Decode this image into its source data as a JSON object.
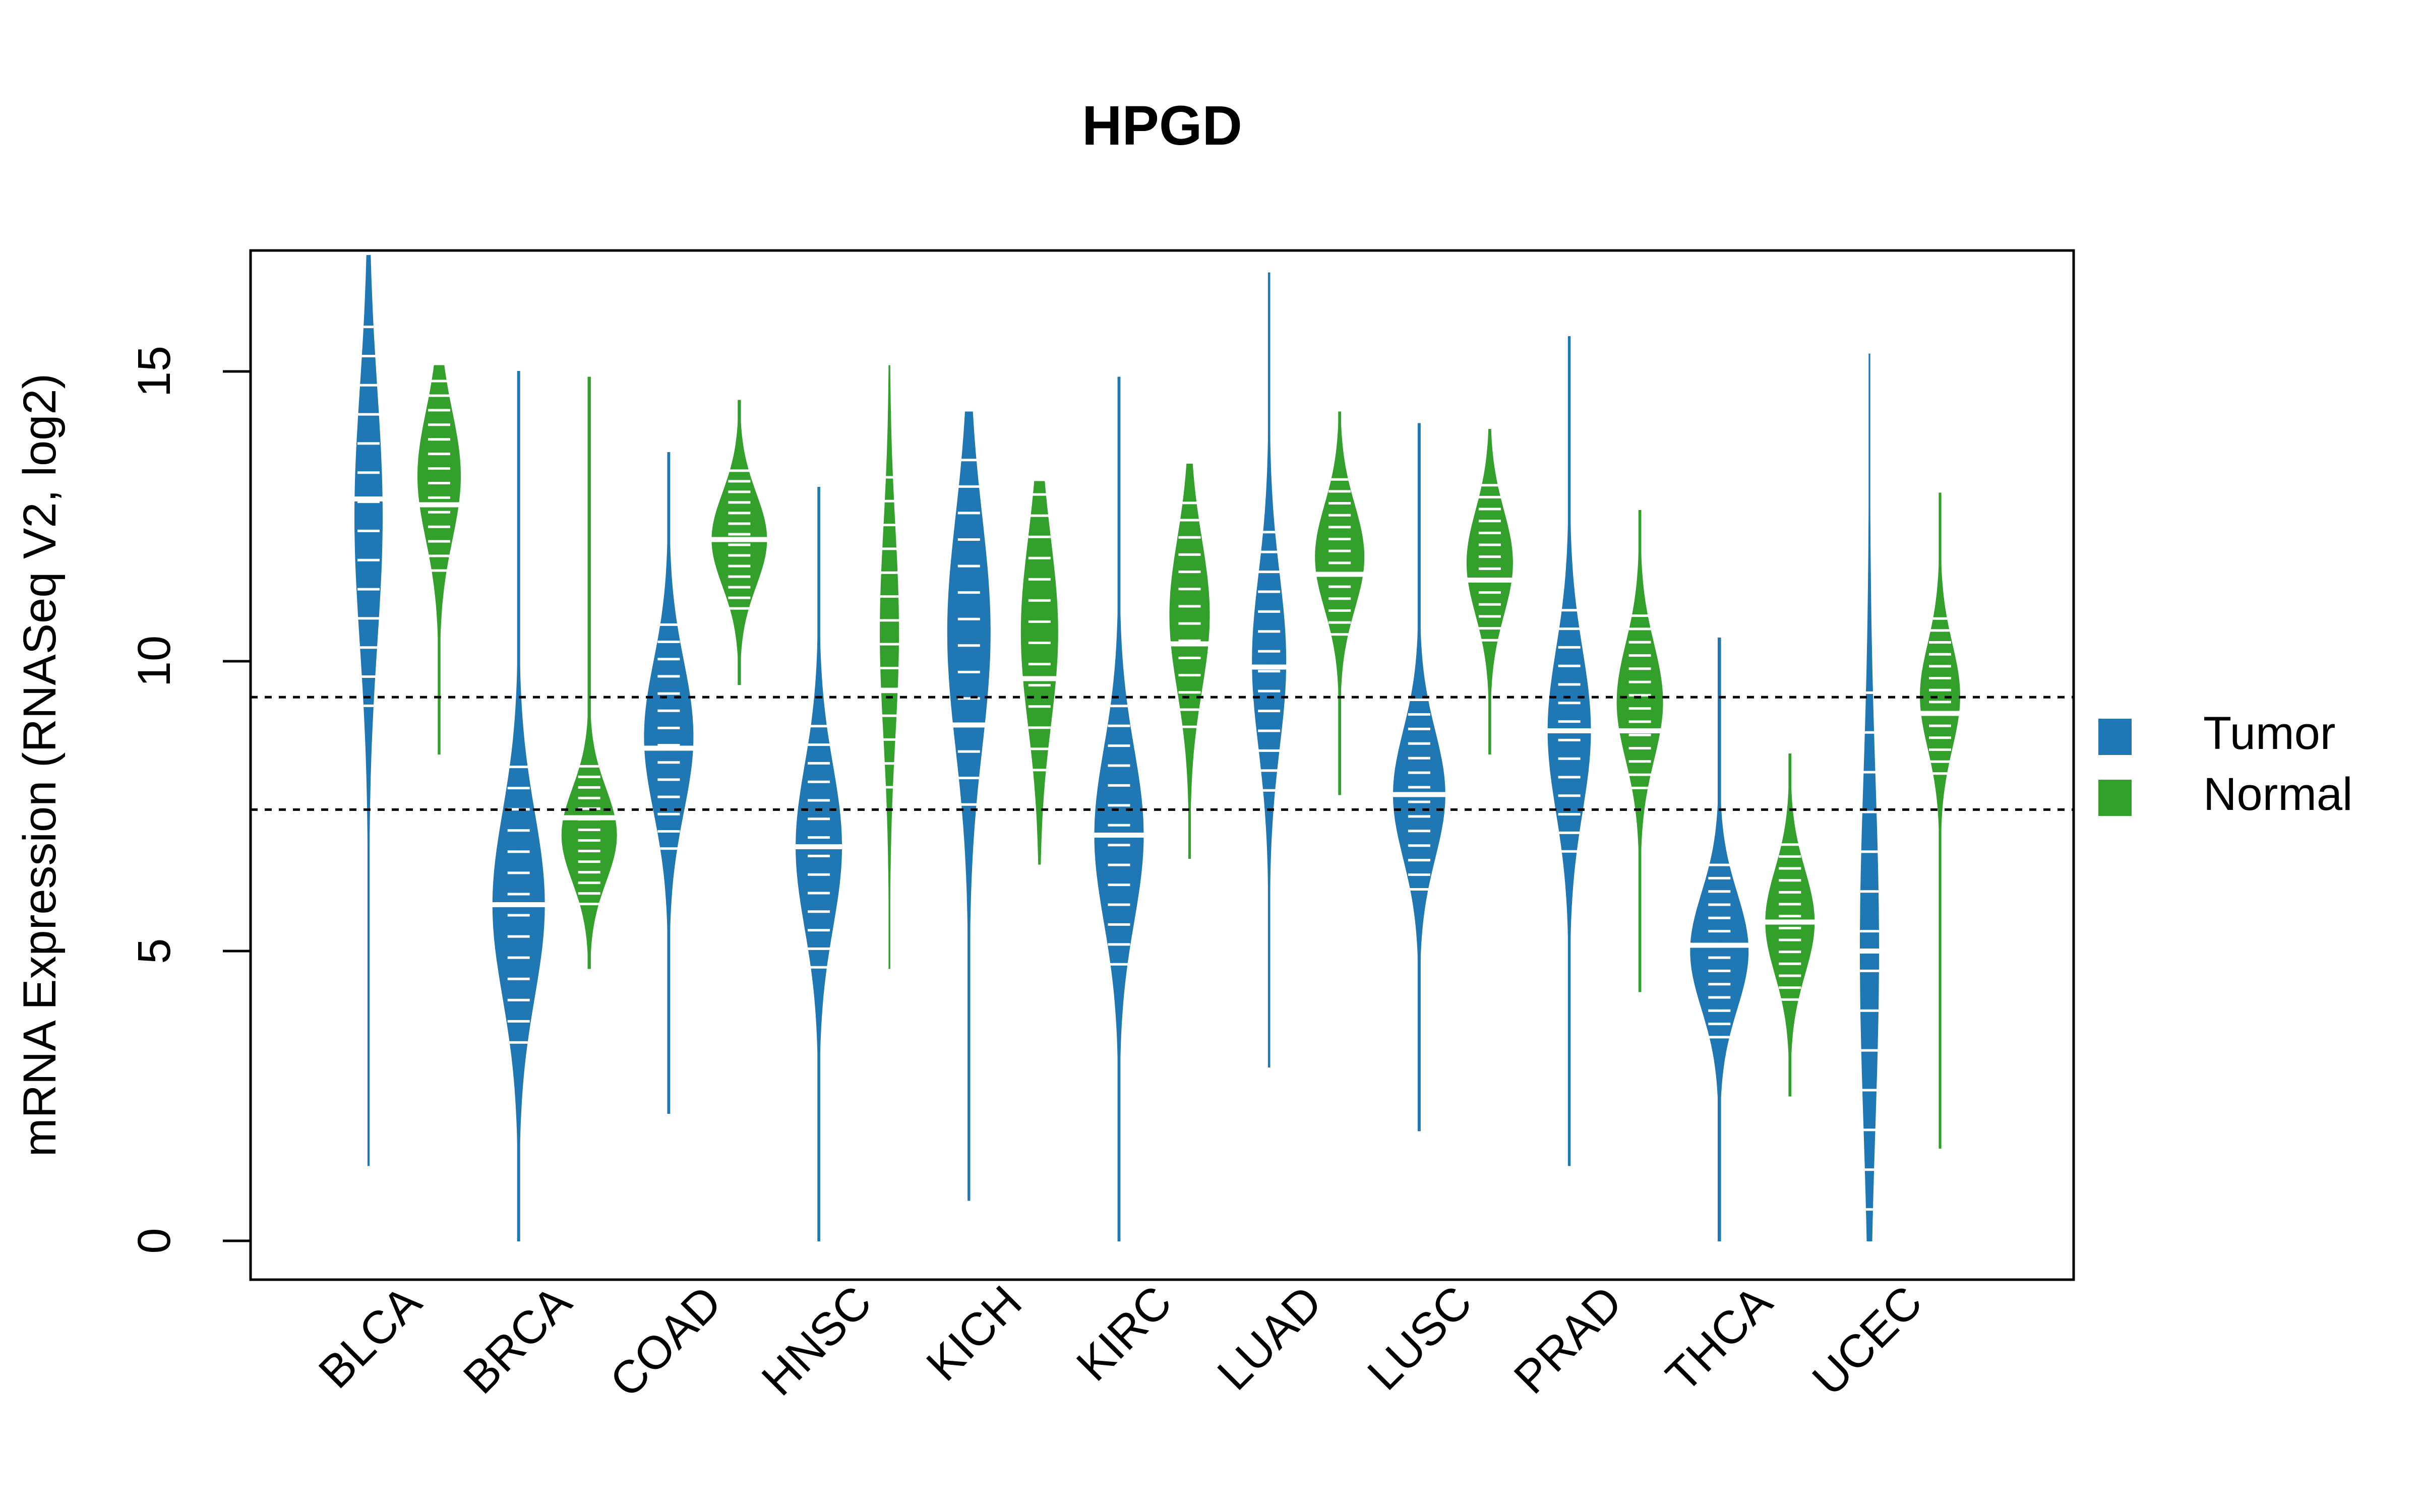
{
  "chart_data": {
    "type": "violin",
    "title": "HPGD",
    "xlabel": "",
    "ylabel": "mRNA Expression (RNASeq V2, log2)",
    "ylim": [
      -0.6,
      17.0
    ],
    "yticks": [
      0,
      5,
      10,
      15
    ],
    "ytick_labels": [
      "0",
      "5",
      "10",
      "15"
    ],
    "grid": false,
    "reference_lines": [
      {
        "y": 9.38,
        "style": "dotted",
        "color": "#000000"
      },
      {
        "y": 7.44,
        "style": "dotted",
        "color": "#000000"
      }
    ],
    "legend": {
      "placement": "right",
      "entries": [
        {
          "label": "Tumor",
          "color": "#1f77b4"
        },
        {
          "label": "Normal",
          "color": "#33a02c"
        }
      ]
    },
    "categories": [
      "BLCA",
      "BRCA",
      "COAD",
      "HNSC",
      "KICH",
      "KIRC",
      "LUAD",
      "LUSC",
      "PRAD",
      "THCA",
      "UCEC"
    ],
    "series": [
      {
        "name": "Tumor",
        "color": "#1f77b4",
        "groups": [
          {
            "category": "BLCA",
            "min": 1.3,
            "max": 17.0,
            "median": 12.8,
            "mode": 12.5,
            "spread": 2.2,
            "density": 0.45
          },
          {
            "category": "BRCA",
            "min": 0.0,
            "max": 15.0,
            "median": 5.8,
            "mode": 5.8,
            "spread": 1.6,
            "density": 0.85
          },
          {
            "category": "COAD",
            "min": 2.2,
            "max": 13.6,
            "median": 8.5,
            "mode": 8.7,
            "spread": 1.3,
            "density": 0.8
          },
          {
            "category": "HNSC",
            "min": 0.0,
            "max": 13.0,
            "median": 6.8,
            "mode": 6.8,
            "spread": 1.4,
            "density": 0.75
          },
          {
            "category": "KICH",
            "min": 0.7,
            "max": 14.3,
            "median": 8.9,
            "mode": 10.5,
            "spread": 2.0,
            "density": 0.7
          },
          {
            "category": "KIRC",
            "min": 0.0,
            "max": 14.9,
            "median": 7.0,
            "mode": 7.0,
            "spread": 1.5,
            "density": 0.8
          },
          {
            "category": "LUAD",
            "min": 3.0,
            "max": 16.7,
            "median": 9.9,
            "mode": 10.0,
            "spread": 1.5,
            "density": 0.55
          },
          {
            "category": "LUSC",
            "min": 1.9,
            "max": 14.1,
            "median": 7.7,
            "mode": 7.7,
            "spread": 1.1,
            "density": 0.85
          },
          {
            "category": "PRAD",
            "min": 1.3,
            "max": 15.6,
            "median": 8.8,
            "mode": 8.8,
            "spread": 1.4,
            "density": 0.7
          },
          {
            "category": "THCA",
            "min": 0.0,
            "max": 10.4,
            "median": 5.1,
            "mode": 5.0,
            "spread": 1.0,
            "density": 0.95
          },
          {
            "category": "UCEC",
            "min": 0.0,
            "max": 15.3,
            "median": 5.0,
            "mode": 5.0,
            "spread": 3.0,
            "density": 0.3
          }
        ]
      },
      {
        "name": "Normal",
        "color": "#33a02c",
        "groups": [
          {
            "category": "BLCA",
            "min": 8.4,
            "max": 15.1,
            "median": 12.7,
            "mode": 13.2,
            "spread": 1.1,
            "density": 0.7
          },
          {
            "category": "BRCA",
            "min": 4.7,
            "max": 14.9,
            "median": 7.3,
            "mode": 7.0,
            "spread": 0.8,
            "density": 0.9
          },
          {
            "category": "COAD",
            "min": 9.6,
            "max": 14.5,
            "median": 12.1,
            "mode": 12.1,
            "spread": 0.8,
            "density": 0.9
          },
          {
            "category": "HNSC",
            "min": 4.7,
            "max": 15.1,
            "median": 9.5,
            "mode": 10.5,
            "spread": 1.8,
            "density": 0.3
          },
          {
            "category": "KICH",
            "min": 6.5,
            "max": 13.1,
            "median": 9.7,
            "mode": 10.5,
            "spread": 1.6,
            "density": 0.6
          },
          {
            "category": "KIRC",
            "min": 6.6,
            "max": 13.4,
            "median": 10.3,
            "mode": 10.8,
            "spread": 1.3,
            "density": 0.65
          },
          {
            "category": "LUAD",
            "min": 7.7,
            "max": 14.3,
            "median": 11.5,
            "mode": 11.8,
            "spread": 0.9,
            "density": 0.8
          },
          {
            "category": "LUSC",
            "min": 8.4,
            "max": 14.0,
            "median": 11.4,
            "mode": 11.7,
            "spread": 0.9,
            "density": 0.75
          },
          {
            "category": "PRAD",
            "min": 4.3,
            "max": 12.6,
            "median": 8.8,
            "mode": 9.3,
            "spread": 1.0,
            "density": 0.75
          },
          {
            "category": "THCA",
            "min": 2.5,
            "max": 8.4,
            "median": 5.5,
            "mode": 5.5,
            "spread": 0.9,
            "density": 0.8
          },
          {
            "category": "UCEC",
            "min": 1.6,
            "max": 12.9,
            "median": 9.1,
            "mode": 9.4,
            "spread": 0.9,
            "density": 0.65
          }
        ]
      }
    ]
  }
}
